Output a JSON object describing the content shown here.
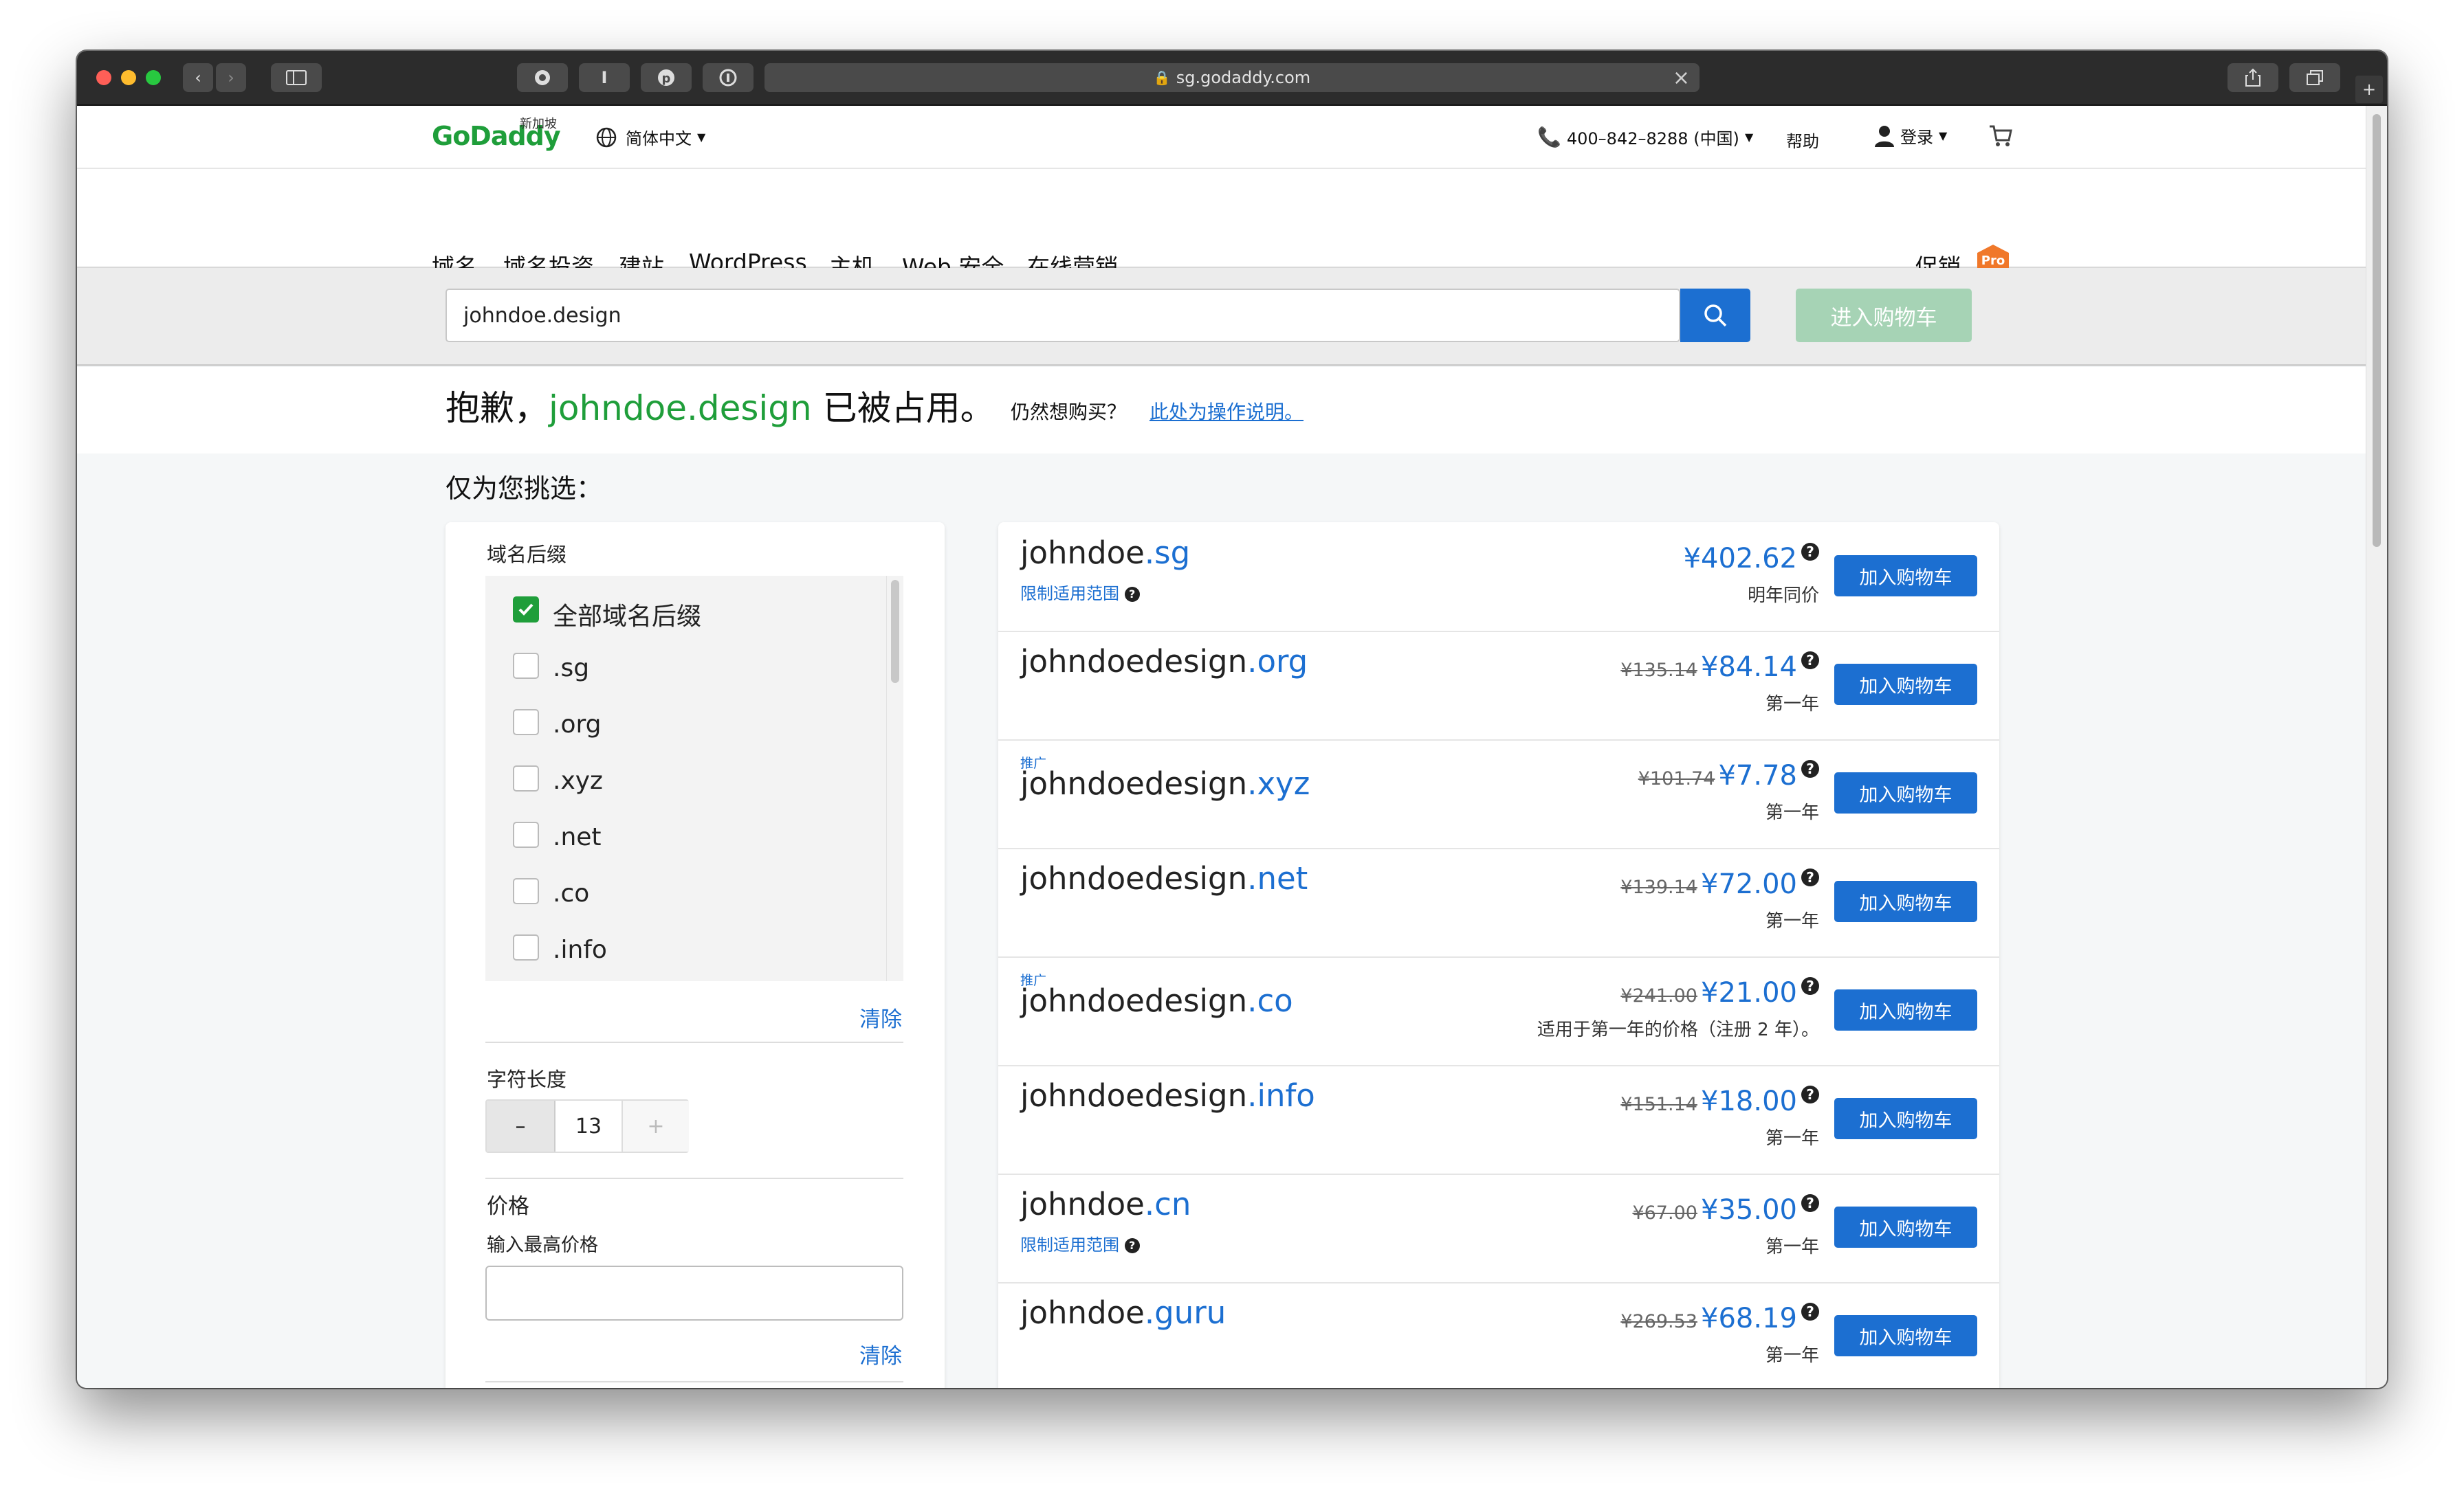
{
  "browser": {
    "url": "sg.godaddy.com"
  },
  "header": {
    "logo_text": "GoDaddy",
    "logo_sub": "新加坡",
    "language": "简体中文",
    "phone": "400–842–8288 (中国)",
    "help": "帮助",
    "login": "登录"
  },
  "nav": {
    "items": [
      "域名",
      "域名投资",
      "建站",
      "WordPress",
      "主机",
      "Web 安全",
      "在线营销"
    ],
    "promo": "促销",
    "pro_badge": "Pro"
  },
  "search": {
    "value": "johndoe.design",
    "go_to_cart": "进入购物车"
  },
  "notice": {
    "prefix": "抱歉，",
    "domain": "johndoe.design",
    "suffix": "已被占用。",
    "still_buy": "仍然想购买？",
    "instructions_link": "此处为操作说明。"
  },
  "section_title": "仅为您挑选：",
  "filters": {
    "tld_title": "域名后缀",
    "tld_options": [
      {
        "label": "全部域名后缀",
        "checked": true
      },
      {
        "label": ".sg",
        "checked": false
      },
      {
        "label": ".org",
        "checked": false
      },
      {
        "label": ".xyz",
        "checked": false
      },
      {
        "label": ".net",
        "checked": false
      },
      {
        "label": ".co",
        "checked": false
      },
      {
        "label": ".info",
        "checked": false
      }
    ],
    "clear": "清除",
    "length_title": "字符长度",
    "length_value": "13",
    "minus": "–",
    "plus": "+",
    "price_title": "价格",
    "max_price_label": "输入最高价格",
    "max_price_value": "",
    "clear2": "清除"
  },
  "results": [
    {
      "promo": "",
      "name": "johndoe",
      "tld": ".sg",
      "limit": "限制适用范围",
      "old_price": "",
      "price": "¥402.62",
      "note": "明年同价",
      "button": "加入购物车"
    },
    {
      "promo": "",
      "name": "johndoedesign",
      "tld": ".org",
      "limit": "",
      "old_price": "¥135.14",
      "price": "¥84.14",
      "note": "第一年",
      "button": "加入购物车"
    },
    {
      "promo": "推广",
      "name": "johndoedesign",
      "tld": ".xyz",
      "limit": "",
      "old_price": "¥101.74",
      "price": "¥7.78",
      "note": "第一年",
      "button": "加入购物车"
    },
    {
      "promo": "",
      "name": "johndoedesign",
      "tld": ".net",
      "limit": "",
      "old_price": "¥139.14",
      "price": "¥72.00",
      "note": "第一年",
      "button": "加入购物车"
    },
    {
      "promo": "推广",
      "name": "johndoedesign",
      "tld": ".co",
      "limit": "",
      "old_price": "¥241.00",
      "price": "¥21.00",
      "note": "适用于第一年的价格（注册 2 年）。",
      "button": "加入购物车"
    },
    {
      "promo": "",
      "name": "johndoedesign",
      "tld": ".info",
      "limit": "",
      "old_price": "¥151.14",
      "price": "¥18.00",
      "note": "第一年",
      "button": "加入购物车"
    },
    {
      "promo": "",
      "name": "johndoe",
      "tld": ".cn",
      "limit": "限制适用范围",
      "old_price": "¥67.00",
      "price": "¥35.00",
      "note": "第一年",
      "button": "加入购物车"
    },
    {
      "promo": "",
      "name": "johndoe",
      "tld": ".guru",
      "limit": "",
      "old_price": "¥269.53",
      "price": "¥68.19",
      "note": "第一年",
      "button": "加入购物车"
    }
  ],
  "colors": {
    "brand_green": "#1f9e3a",
    "link_blue": "#1c6fd1",
    "cart_button_disabled": "#a6d3b5",
    "pro_badge": "#f0782a"
  }
}
